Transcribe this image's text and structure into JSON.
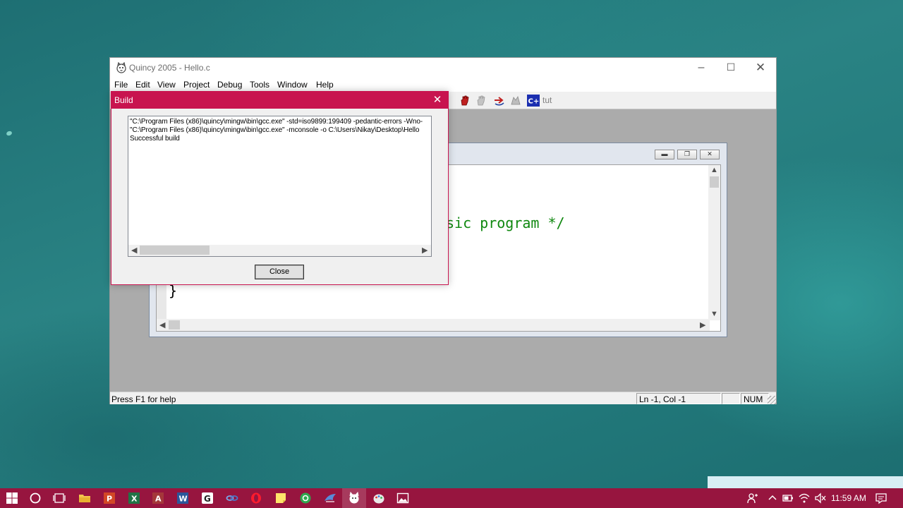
{
  "app": {
    "title": "Quincy 2005 - Hello.c",
    "menu": [
      "File",
      "Edit",
      "View",
      "Project",
      "Debug",
      "Tools",
      "Window",
      "Help"
    ],
    "toolbar_text": "tut",
    "editor": {
      "code_visible_1": "sic program */",
      "code_visible_2": "}"
    },
    "status": {
      "help": "Press F1 for help",
      "position": "Ln -1, Col -1",
      "num": "NUM"
    }
  },
  "build_dialog": {
    "title": "Build",
    "lines": [
      "\"C:\\Program Files (x86)\\quincy\\mingw\\bin\\gcc.exe\" -std=iso9899:199409 -pedantic-errors -Wno-",
      "\"C:\\Program Files (x86)\\quincy\\mingw\\bin\\gcc.exe\" -mconsole -o C:\\Users\\Nikay\\Desktop\\Hello",
      "Successful build"
    ],
    "close_label": "Close"
  },
  "taskbar": {
    "clock": "11:59 AM",
    "icons": [
      "start-icon",
      "cortana-icon",
      "task-view-icon",
      "file-explorer-icon",
      "powerpoint-icon",
      "excel-icon",
      "access-icon",
      "word-icon",
      "g-app-icon",
      "link-icon",
      "opera-icon",
      "sticky-notes-icon",
      "green-app-icon",
      "wing-app-icon",
      "quincy-icon",
      "paint-icon",
      "photos-icon"
    ]
  },
  "colors": {
    "accent": "#c8144f",
    "taskbar": "#97153f",
    "comment": "#108810",
    "mdi_background": "#ababab"
  }
}
